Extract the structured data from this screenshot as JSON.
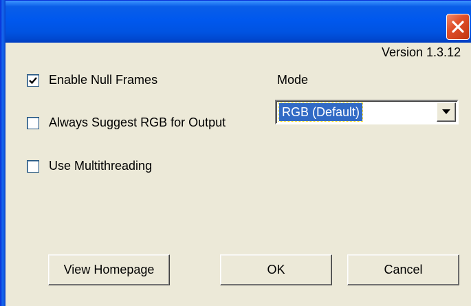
{
  "window": {
    "title": "",
    "close_icon": "close-x-icon"
  },
  "version_text": "Version 1.3.12",
  "options": [
    {
      "label": "Enable Null Frames",
      "checked": true
    },
    {
      "label": "Always Suggest RGB for Output",
      "checked": false
    },
    {
      "label": "Use Multithreading",
      "checked": false
    }
  ],
  "mode": {
    "label": "Mode",
    "selected": "RGB (Default)"
  },
  "buttons": {
    "homepage": "View Homepage",
    "ok": "OK",
    "cancel": "Cancel"
  },
  "colors": {
    "title_bar": "#0058ee",
    "close_button": "#e0502a",
    "dialog_bg": "#ece9d8",
    "selection": "#316ac5"
  }
}
